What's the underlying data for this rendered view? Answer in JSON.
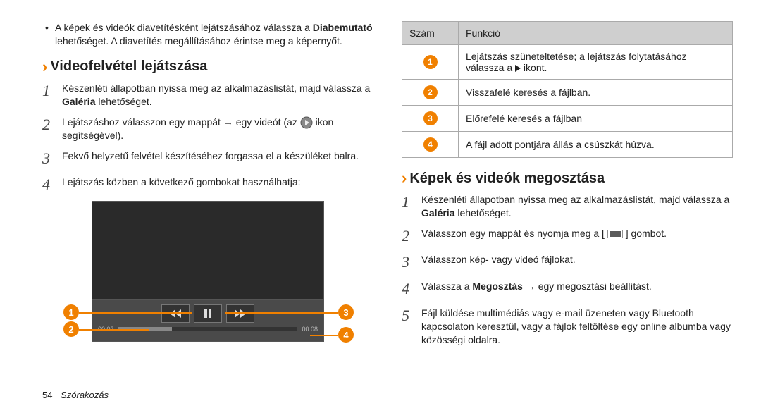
{
  "left": {
    "bullet_pre": "A képek és videók diavetítésként lejátszásához válassza a ",
    "bullet_bold": "Diabemutató",
    "bullet_post": " lehetőséget. A diavetítés megállításához érintse meg a képernyőt.",
    "section_title": "Videofelvétel lejátszása",
    "steps": {
      "s1_pre": "Készenléti állapotban nyissa meg az alkalmazáslistát, majd válassza a ",
      "s1_bold": "Galéria",
      "s1_post": " lehetőséget.",
      "s2_pre": "Lejátszáshoz válasszon egy mappát → egy videót (az ",
      "s2_post": " ikon segítségével).",
      "s3": "Fekvő helyzetű felvétel készítéséhez forgassa el a készüléket balra.",
      "s4": "Lejátszás közben a következő gombokat használhatja:"
    },
    "player": {
      "time_current": "00:02",
      "time_total": "00:08"
    }
  },
  "right": {
    "table": {
      "h_num": "Szám",
      "h_func": "Funkció",
      "r1_pre": "Lejátszás szüneteltetése; a lejátszás folytatásához válassza a ",
      "r1_post": " ikont.",
      "r2": "Visszafelé keresés a fájlban.",
      "r3": "Előrefelé keresés a fájlban",
      "r4": "A fájl adott pontjára állás a csúszkát húzva."
    },
    "section_title": "Képek és videók megosztása",
    "steps": {
      "s1_pre": "Készenléti állapotban nyissa meg az alkalmazáslistát, majd válassza a ",
      "s1_bold": "Galéria",
      "s1_post": " lehetőséget.",
      "s2_pre": "Válasszon egy mappát és nyomja meg a [",
      "s2_post": "] gombot.",
      "s3": "Válasszon kép- vagy videó fájlokat.",
      "s4_pre": "Válassza a ",
      "s4_bold": "Megosztás",
      "s4_post": " → egy megosztási beállítást.",
      "s5": "Fájl küldése multimédiás vagy e-mail üzeneten vagy Bluetooth kapcsolaton keresztül, vagy a fájlok feltöltése egy online albumba vagy közösségi oldalra."
    }
  },
  "footer": {
    "page": "54",
    "label": "Szórakozás"
  }
}
